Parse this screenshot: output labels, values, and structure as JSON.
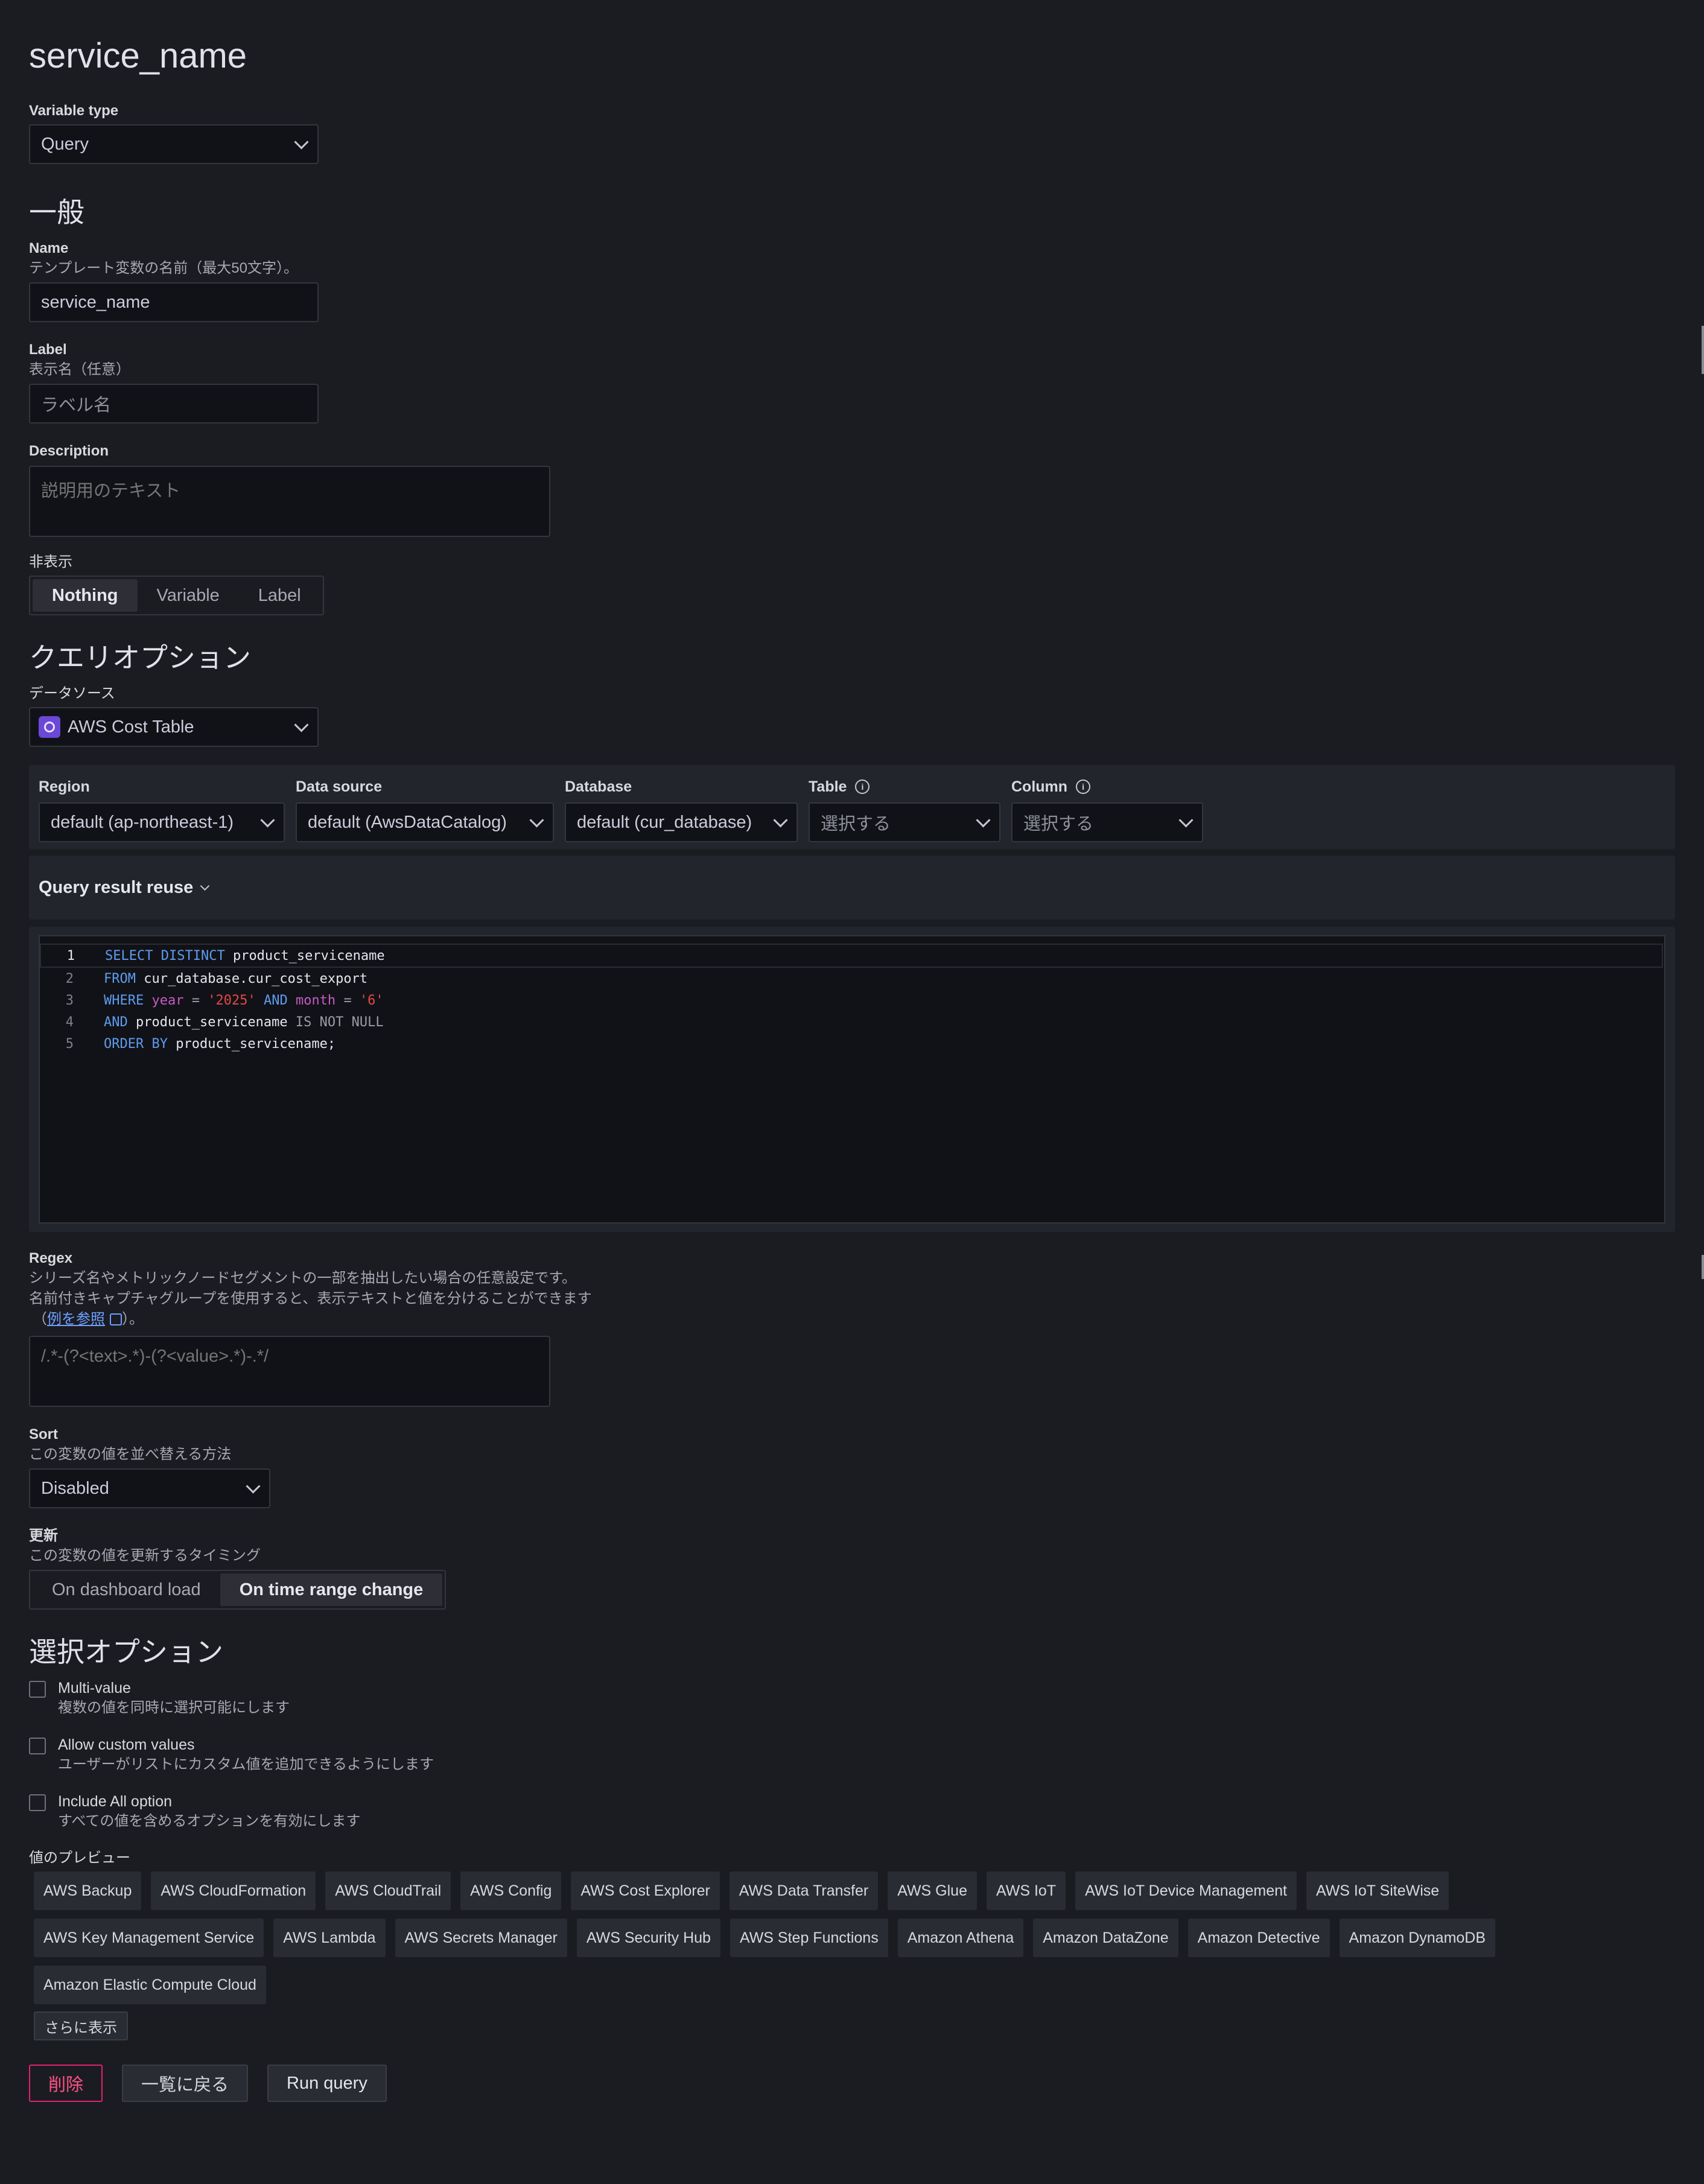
{
  "title": "service_name",
  "variable_type": {
    "label": "Variable type",
    "value": "Query"
  },
  "general": {
    "heading": "一般",
    "name": {
      "label": "Name",
      "desc": "テンプレート変数の名前（最大50文字）。",
      "value": "service_name"
    },
    "label_field": {
      "label": "Label",
      "desc": "表示名（任意）",
      "placeholder": "ラベル名"
    },
    "description": {
      "label": "Description",
      "placeholder": "説明用のテキスト"
    },
    "hide": {
      "label": "非表示",
      "options": [
        "Nothing",
        "Variable",
        "Label"
      ],
      "selected": "Nothing"
    }
  },
  "query_options": {
    "heading": "クエリオプション",
    "datasource": {
      "label": "データソース",
      "value": "AWS Cost Table"
    },
    "region": {
      "label": "Region",
      "value": "default (ap-northeast-1)"
    },
    "data_source": {
      "label": "Data source",
      "value": "default (AwsDataCatalog)"
    },
    "database": {
      "label": "Database",
      "value": "default (cur_database)"
    },
    "table": {
      "label": "Table",
      "value": "選択する"
    },
    "column": {
      "label": "Column",
      "value": "選択する"
    },
    "reuse": "Query result reuse",
    "code_lines": [
      "SELECT DISTINCT product_servicename",
      "FROM cur_database.cur_cost_export",
      "WHERE year = '2025' AND month = '6'",
      "AND product_servicename IS NOT NULL",
      "ORDER BY product_servicename;"
    ],
    "code_tokens": {
      "l1": {
        "a": "SELECT",
        "b": "DISTINCT",
        "c": " product_servicename"
      },
      "l2": {
        "a": "FROM",
        "b": " cur_database.cur_cost_export"
      },
      "l3": {
        "a": "WHERE",
        "b": "year",
        "c": "=",
        "d": "'2025'",
        "e": "AND",
        "f": "month",
        "g": "=",
        "h": "'6'"
      },
      "l4": {
        "a": "AND",
        "b": " product_servicename ",
        "c": "IS NOT NULL"
      },
      "l5": {
        "a": "ORDER BY",
        "b": " product_servicename;"
      }
    },
    "regex": {
      "label": "Regex",
      "desc1": "シリーズ名やメトリックノードセグメントの一部を抽出したい場合の任意設定です。",
      "desc2": "名前付きキャプチャグループを使用すると、表示テキストと値を分けることができます",
      "desc3_pre": "（",
      "desc3_link": "例を参照",
      "desc3_post": "）。",
      "placeholder": "/.*-(?<text>.*)-(?<value>.*)-.*/"
    },
    "sort": {
      "label": "Sort",
      "desc": "この変数の値を並べ替える方法",
      "value": "Disabled"
    },
    "refresh": {
      "label": "更新",
      "desc": "この変数の値を更新するタイミング",
      "options": [
        "On dashboard load",
        "On time range change"
      ],
      "selected": "On time range change"
    }
  },
  "selection_options": {
    "heading": "選択オプション",
    "multi_value": {
      "label": "Multi-value",
      "desc": "複数の値を同時に選択可能にします",
      "checked": false
    },
    "custom_values": {
      "label": "Allow custom values",
      "desc": "ユーザーがリストにカスタム値を追加できるようにします",
      "checked": false
    },
    "include_all": {
      "label": "Include All option",
      "desc": "すべての値を含めるオプションを有効にします",
      "checked": false
    }
  },
  "preview": {
    "label": "値のプレビュー",
    "values": [
      "AWS Backup",
      "AWS CloudFormation",
      "AWS CloudTrail",
      "AWS Config",
      "AWS Cost Explorer",
      "AWS Data Transfer",
      "AWS Glue",
      "AWS IoT",
      "AWS IoT Device Management",
      "AWS IoT SiteWise",
      "AWS Key Management Service",
      "AWS Lambda",
      "AWS Secrets Manager",
      "AWS Security Hub",
      "AWS Step Functions",
      "Amazon Athena",
      "Amazon DataZone",
      "Amazon Detective",
      "Amazon DynamoDB",
      "Amazon Elastic Compute Cloud"
    ],
    "show_more": "さらに表示"
  },
  "actions": {
    "delete": "削除",
    "back": "一覧に戻る",
    "run": "Run query"
  },
  "colors": {
    "background": "#1b1c21",
    "keyword": "#5e9cf0",
    "string": "#e54848",
    "identifier": "#c75ac7",
    "danger": "#e0226e",
    "datasource_icon": "#6b48d6"
  }
}
